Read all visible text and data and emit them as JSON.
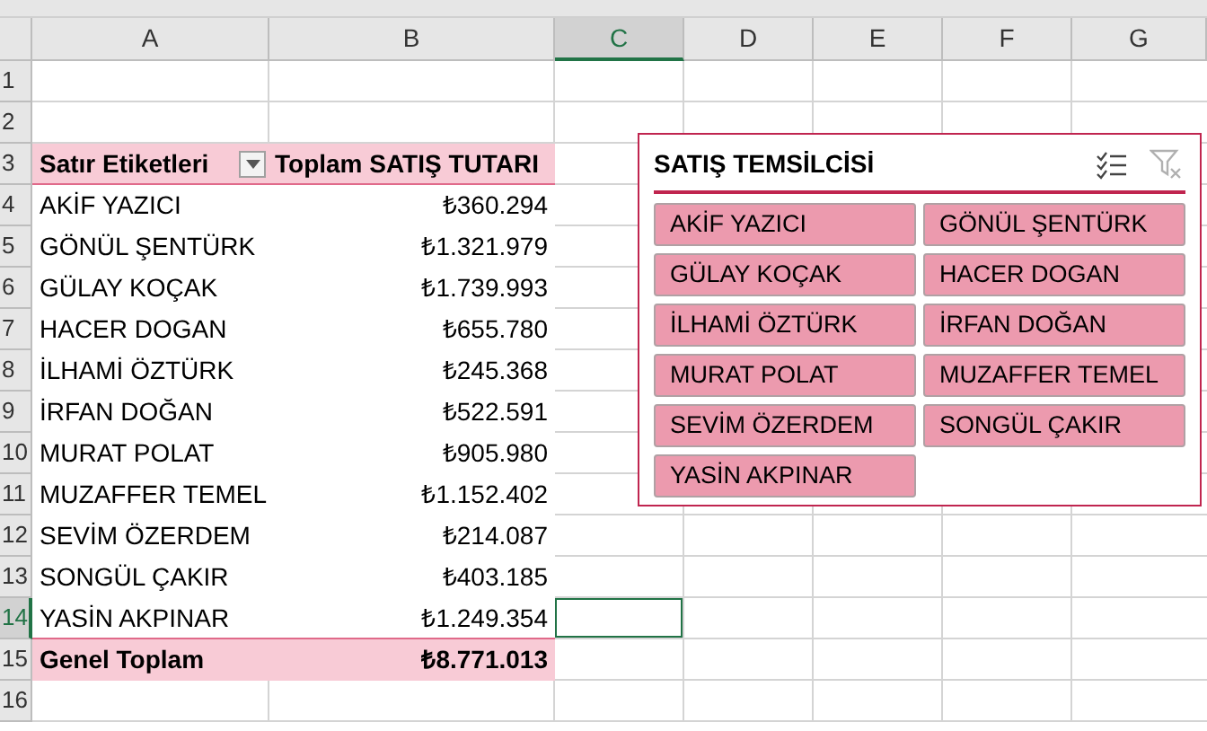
{
  "columns": [
    {
      "label": "A",
      "selected": false
    },
    {
      "label": "B",
      "selected": false
    },
    {
      "label": "C",
      "selected": true
    },
    {
      "label": "D",
      "selected": false
    },
    {
      "label": "E",
      "selected": false
    },
    {
      "label": "F",
      "selected": false
    },
    {
      "label": "G",
      "selected": false
    }
  ],
  "row_numbers": [
    {
      "label": "1",
      "selected": false
    },
    {
      "label": "2",
      "selected": false
    },
    {
      "label": "3",
      "selected": false
    },
    {
      "label": "4",
      "selected": false
    },
    {
      "label": "5",
      "selected": false
    },
    {
      "label": "6",
      "selected": false
    },
    {
      "label": "7",
      "selected": false
    },
    {
      "label": "8",
      "selected": false
    },
    {
      "label": "9",
      "selected": false
    },
    {
      "label": "10",
      "selected": false
    },
    {
      "label": "11",
      "selected": false
    },
    {
      "label": "12",
      "selected": false
    },
    {
      "label": "13",
      "selected": false
    },
    {
      "label": "14",
      "selected": true
    },
    {
      "label": "15",
      "selected": false
    },
    {
      "label": "16",
      "selected": false
    }
  ],
  "pivot": {
    "row_label_header": "Satır Etiketleri",
    "value_header": "Toplam SATIŞ TUTARI",
    "rows": [
      {
        "name": "AKİF YAZICI",
        "amount": "₺360.294"
      },
      {
        "name": "GÖNÜL ŞENTÜRK",
        "amount": "₺1.321.979"
      },
      {
        "name": "GÜLAY KOÇAK",
        "amount": "₺1.739.993"
      },
      {
        "name": "HACER DOGAN",
        "amount": "₺655.780"
      },
      {
        "name": "İLHAMİ ÖZTÜRK",
        "amount": "₺245.368"
      },
      {
        "name": "İRFAN DOĞAN",
        "amount": "₺522.591"
      },
      {
        "name": "MURAT POLAT",
        "amount": "₺905.980"
      },
      {
        "name": "MUZAFFER TEMEL",
        "amount": "₺1.152.402"
      },
      {
        "name": "SEVİM ÖZERDEM",
        "amount": "₺214.087"
      },
      {
        "name": "SONGÜL ÇAKIR",
        "amount": "₺403.185"
      },
      {
        "name": "YASİN AKPINAR",
        "amount": "₺1.249.354"
      }
    ],
    "total": {
      "label": "Genel Toplam",
      "amount": "₺8.771.013"
    }
  },
  "slicer": {
    "title": "SATIŞ TEMSİLCİSİ",
    "items": [
      {
        "label": "AKİF YAZICI",
        "selected": true
      },
      {
        "label": "GÖNÜL ŞENTÜRK",
        "selected": true
      },
      {
        "label": "GÜLAY KOÇAK",
        "selected": true
      },
      {
        "label": "HACER DOGAN",
        "selected": true
      },
      {
        "label": "İLHAMİ ÖZTÜRK",
        "selected": true
      },
      {
        "label": "İRFAN DOĞAN",
        "selected": true
      },
      {
        "label": "MURAT POLAT",
        "selected": true
      },
      {
        "label": "MUZAFFER TEMEL",
        "selected": true
      },
      {
        "label": "SEVİM ÖZERDEM",
        "selected": true
      },
      {
        "label": "SONGÜL ÇAKIR",
        "selected": true
      },
      {
        "label": "YASİN AKPINAR",
        "selected": true
      }
    ]
  }
}
